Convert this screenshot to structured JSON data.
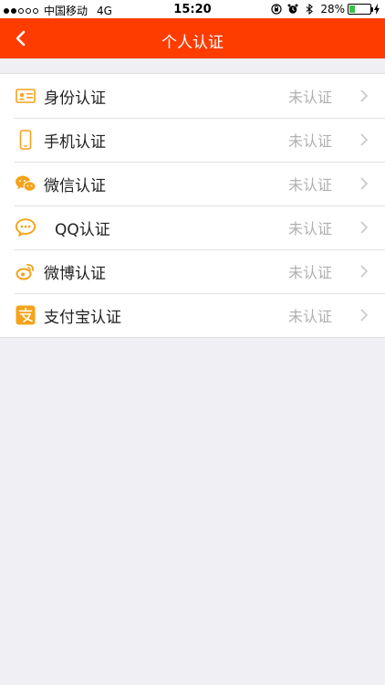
{
  "status_bar": {
    "carrier": "中国移动",
    "network": "4G",
    "time": "15:20",
    "battery_text": "28%",
    "battery_level": 0.28
  },
  "nav": {
    "title": "个人认证",
    "back_icon": "chevron-left-icon"
  },
  "colors": {
    "nav_bg": "#ff3c00",
    "icon_orange": "#f4a31a",
    "status_gray": "#b0b0b0"
  },
  "list": {
    "items": [
      {
        "icon": "id-card-icon",
        "label": "身份认证",
        "status": "未认证"
      },
      {
        "icon": "phone-icon",
        "label": "手机认证",
        "status": "未认证"
      },
      {
        "icon": "wechat-icon",
        "label": "微信认证",
        "status": "未认证"
      },
      {
        "icon": "qq-icon",
        "label": "QQ认证",
        "status": "未认证"
      },
      {
        "icon": "weibo-icon",
        "label": "微博认证",
        "status": "未认证"
      },
      {
        "icon": "alipay-icon",
        "label": "支付宝认证",
        "status": "未认证"
      }
    ]
  }
}
